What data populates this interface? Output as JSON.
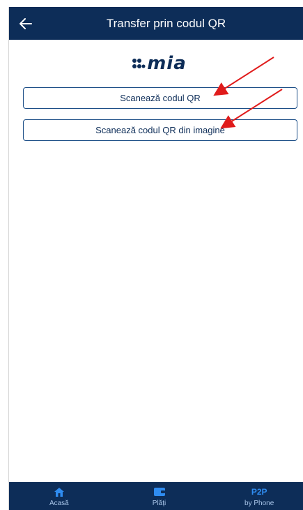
{
  "header": {
    "title": "Transfer prin codul QR",
    "back_icon": "arrow-left-icon",
    "background": "#0d2d58"
  },
  "logo": {
    "text": "mia",
    "icon": "mia-dots-logo"
  },
  "actions": {
    "scan_qr_label": "Scanează codul QR",
    "scan_qr_image_label": "Scanează codul QR din imagine"
  },
  "bottom_nav": {
    "items": [
      {
        "label": "Acasă",
        "icon": "home-icon"
      },
      {
        "label": "Plăți",
        "icon": "wallet-icon"
      },
      {
        "top": "P2P",
        "label": "by Phone"
      }
    ]
  },
  "colors": {
    "brand_navy": "#0d2d58",
    "accent_blue": "#2f8cf0",
    "annotation_red": "#e01b1b"
  }
}
